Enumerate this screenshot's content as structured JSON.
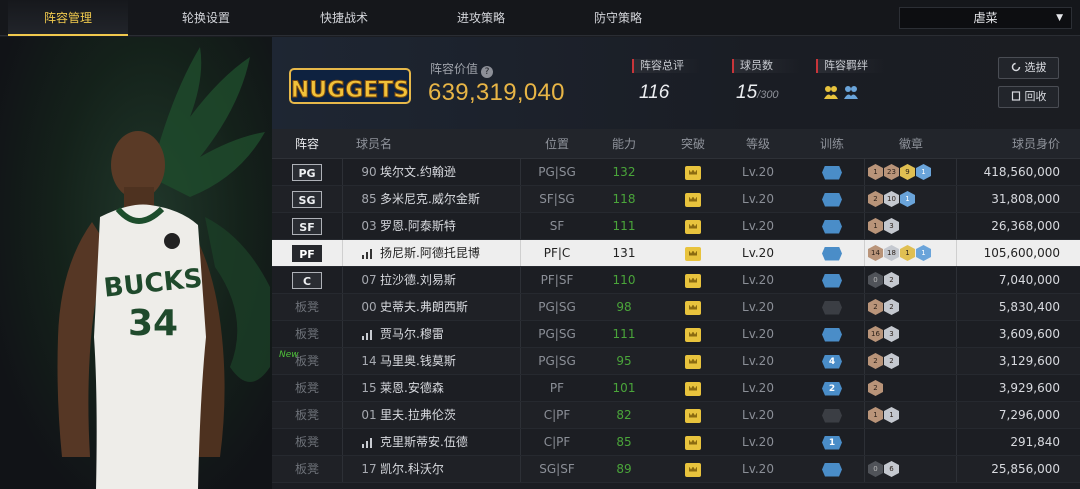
{
  "tabs": [
    {
      "label": "阵容管理",
      "active": true
    },
    {
      "label": "轮换设置",
      "active": false
    },
    {
      "label": "快捷战术",
      "active": false
    },
    {
      "label": "进攻策略",
      "active": false
    },
    {
      "label": "防守策略",
      "active": false
    }
  ],
  "dropdown": {
    "value": "虐菜"
  },
  "team_logo_text": "NUGGETS",
  "player_art": {
    "jersey_team": "BUCKS",
    "jersey_number": "34"
  },
  "header": {
    "value_label": "阵容价值",
    "value": "639,319,040",
    "rating_label": "阵容总评",
    "rating": "116",
    "count_label": "球员数",
    "count": "15",
    "count_max": "/300",
    "bond_label": "阵容羁绊",
    "pick_button": "选拔",
    "recycle_button": "回收"
  },
  "columns": [
    "阵容",
    "球员名",
    "位置",
    "能力",
    "突破",
    "等级",
    "训练",
    "徽章",
    "球员身价"
  ],
  "colors": {
    "accent": "#f0c94d",
    "value": "#e8b546",
    "ability_green": "#4aa53a",
    "stat_red": "#c8353a"
  },
  "rows": [
    {
      "slot": "PG",
      "starter": true,
      "num": "90",
      "name": "埃尔文.约翰逊",
      "pos": "PG|SG",
      "ability": "132",
      "level": "Lv.20",
      "train": {
        "style": "blue",
        "text": ""
      },
      "badges": [
        [
          "bronze",
          "1"
        ],
        [
          "bronze",
          "23"
        ],
        [
          "gold",
          "9"
        ],
        [
          "blue",
          "1"
        ]
      ],
      "value": "418,560,000"
    },
    {
      "slot": "SG",
      "starter": true,
      "num": "85",
      "name": "多米尼克.威尔金斯",
      "pos": "SF|SG",
      "ability": "118",
      "level": "Lv.20",
      "train": {
        "style": "blue",
        "text": ""
      },
      "badges": [
        [
          "bronze",
          "2"
        ],
        [
          "silver",
          "10"
        ],
        [
          "blue",
          "1"
        ]
      ],
      "value": "31,808,000"
    },
    {
      "slot": "SF",
      "starter": true,
      "num": "03",
      "name": "罗恩.阿泰斯特",
      "pos": "SF",
      "ability": "111",
      "level": "Lv.20",
      "train": {
        "style": "blue",
        "text": ""
      },
      "badges": [
        [
          "bronze",
          "1"
        ],
        [
          "silver",
          "3"
        ]
      ],
      "value": "26,368,000"
    },
    {
      "slot": "PF",
      "starter": true,
      "selected": true,
      "num": "",
      "name": "扬尼斯.阿德托昆博",
      "pos": "PF|C",
      "ability": "131",
      "level": "Lv.20",
      "train": {
        "style": "blue",
        "text": ""
      },
      "badges": [
        [
          "bronze",
          "14"
        ],
        [
          "silver",
          "18"
        ],
        [
          "gold",
          "1"
        ],
        [
          "blue",
          "1"
        ]
      ],
      "value": "105,600,000"
    },
    {
      "slot": "C",
      "starter": true,
      "num": "07",
      "name": "拉沙德.刘易斯",
      "pos": "PF|SF",
      "ability": "110",
      "level": "Lv.20",
      "train": {
        "style": "blue",
        "text": ""
      },
      "badges": [
        [
          "dark",
          "0"
        ],
        [
          "silver",
          "2"
        ]
      ],
      "value": "7,040,000"
    },
    {
      "slot": "板凳",
      "starter": false,
      "num": "00",
      "name": "史蒂夫.弗朗西斯",
      "pos": "PG|SG",
      "ability": "98",
      "level": "Lv.20",
      "train": {
        "style": "grey",
        "text": ""
      },
      "badges": [
        [
          "bronze",
          "2"
        ],
        [
          "silver",
          "2"
        ]
      ],
      "value": "5,830,400"
    },
    {
      "slot": "板凳",
      "starter": false,
      "num": "",
      "name": "贾马尔.穆雷",
      "pos": "PG|SG",
      "ability": "111",
      "level": "Lv.20",
      "train": {
        "style": "blue",
        "text": ""
      },
      "badges": [
        [
          "bronze",
          "16"
        ],
        [
          "silver",
          "3"
        ]
      ],
      "value": "3,609,600"
    },
    {
      "slot": "板凳",
      "starter": false,
      "new": true,
      "num": "14",
      "name": "马里奥.钱莫斯",
      "pos": "PG|SG",
      "ability": "95",
      "level": "Lv.20",
      "train": {
        "style": "blue",
        "text": "4"
      },
      "badges": [
        [
          "bronze",
          "2"
        ],
        [
          "silver",
          "2"
        ]
      ],
      "value": "3,129,600"
    },
    {
      "slot": "板凳",
      "starter": false,
      "num": "15",
      "name": "莱恩.安德森",
      "pos": "PF",
      "ability": "101",
      "level": "Lv.20",
      "train": {
        "style": "blue",
        "text": "2"
      },
      "badges": [
        [
          "bronze",
          "2"
        ]
      ],
      "value": "3,929,600"
    },
    {
      "slot": "板凳",
      "starter": false,
      "num": "01",
      "name": "里夫.拉弗伦茨",
      "pos": "C|PF",
      "ability": "82",
      "level": "Lv.20",
      "train": {
        "style": "grey",
        "text": ""
      },
      "badges": [
        [
          "bronze",
          "1"
        ],
        [
          "silver",
          "1"
        ]
      ],
      "value": "7,296,000"
    },
    {
      "slot": "板凳",
      "starter": false,
      "num": "",
      "name": "克里斯蒂安.伍德",
      "pos": "C|PF",
      "ability": "85",
      "level": "Lv.20",
      "train": {
        "style": "blue",
        "text": "1"
      },
      "badges": [],
      "value": "291,840"
    },
    {
      "slot": "板凳",
      "starter": false,
      "num": "17",
      "name": "凯尔.科沃尔",
      "pos": "SG|SF",
      "ability": "89",
      "level": "Lv.20",
      "train": {
        "style": "blue",
        "text": ""
      },
      "badges": [
        [
          "dark",
          "0"
        ],
        [
          "silver",
          "6"
        ]
      ],
      "value": "25,856,000"
    }
  ]
}
